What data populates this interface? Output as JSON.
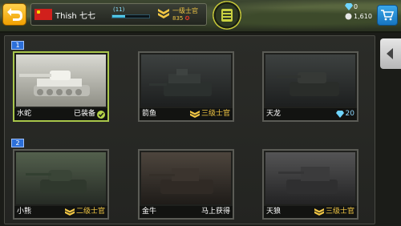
{
  "player": {
    "name": "Thish 七七",
    "level_text": "(11)",
    "xp_progress": 0.35,
    "rank_title": "一级士官",
    "rank_points": "835"
  },
  "currency": {
    "diamonds": "0",
    "coins": "1,610"
  },
  "groups": [
    {
      "label": "1"
    },
    {
      "label": "2"
    }
  ],
  "tanks": [
    {
      "name": "水蛇",
      "status": "已装备",
      "status_type": "equipped",
      "style": "selected"
    },
    {
      "name": "箭鱼",
      "status": "三级士官",
      "status_type": "rank",
      "style": "dark"
    },
    {
      "name": "天龙",
      "status": "20",
      "status_type": "diamond",
      "style": "dark"
    },
    {
      "name": "小熊",
      "status": "二级士官",
      "status_type": "rank",
      "style": "green"
    },
    {
      "name": "金牛",
      "status": "马上获得",
      "status_type": "text",
      "style": "brown"
    },
    {
      "name": "天狼",
      "status": "三级士官",
      "status_type": "rank",
      "style": "grey"
    }
  ],
  "colors": {
    "accent_gold": "#f2c744",
    "selected_border": "#a8c64a",
    "badge_blue": "#2c6fd8"
  },
  "icons": {
    "back": "back-arrow-icon",
    "shop": "cart-icon",
    "side": "chevron-left-icon",
    "center": "ammo-icon"
  }
}
